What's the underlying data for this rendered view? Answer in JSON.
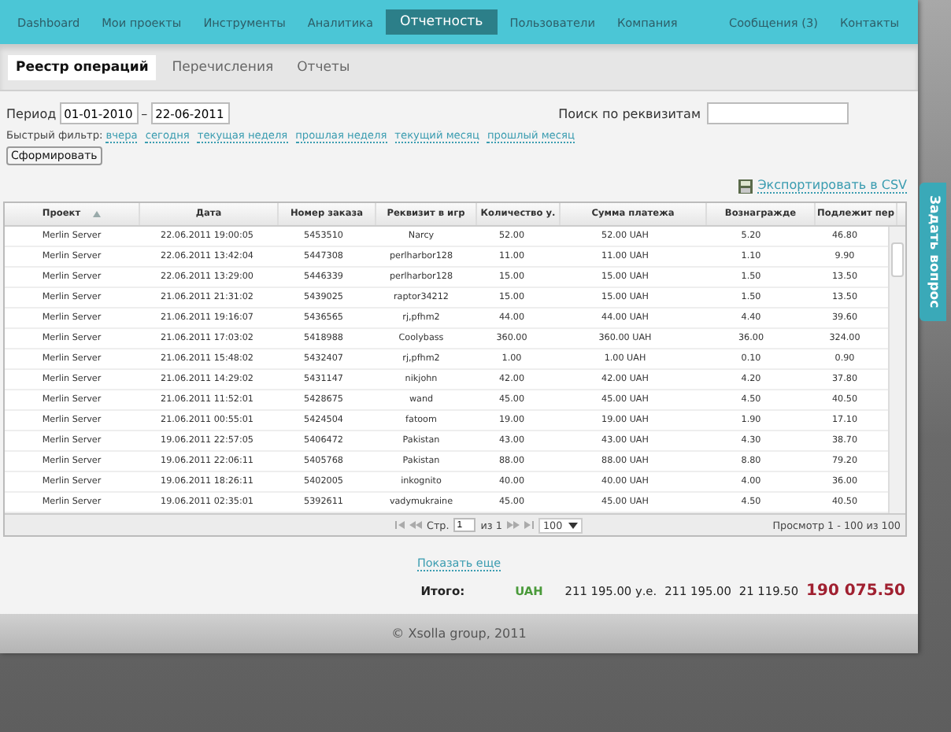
{
  "nav": {
    "items": [
      {
        "label": "Dashboard",
        "selected": false
      },
      {
        "label": "Мои проекты",
        "selected": false
      },
      {
        "label": "Инструменты",
        "selected": false
      },
      {
        "label": "Аналитика",
        "selected": false
      },
      {
        "label": "Отчетность",
        "selected": true
      },
      {
        "label": "Пользователи",
        "selected": false
      },
      {
        "label": "Компания",
        "selected": false
      }
    ],
    "right_items": [
      {
        "label": "Сообщения (3)",
        "selected": false
      },
      {
        "label": "Контакты",
        "selected": false
      }
    ]
  },
  "subtabs": [
    {
      "label": "Реестр операций",
      "selected": true
    },
    {
      "label": "Перечисления",
      "selected": false
    },
    {
      "label": "Отчеты",
      "selected": false
    }
  ],
  "filter": {
    "period_label": "Период",
    "date_from": "01-01-2010",
    "dash": "–",
    "date_to": "22-06-2011",
    "search_label": "Поиск по реквизитам",
    "quick_label": "Быстрый фильтр:",
    "quick_links": [
      "вчера",
      "сегодня",
      "текущая неделя",
      "прошлая неделя",
      "текущий месяц",
      "прошлый месяц"
    ],
    "submit": "Сформировать"
  },
  "export_link": "Экспортировать в CSV",
  "table": {
    "columns": [
      {
        "label": "Проект",
        "sorted": true
      },
      {
        "label": "Дата",
        "sorted": false
      },
      {
        "label": "Номер заказа",
        "sorted": false
      },
      {
        "label": "Реквизит в игр",
        "sorted": false
      },
      {
        "label": "Количество у.",
        "sorted": false
      },
      {
        "label": "Сумма платежа",
        "sorted": false
      },
      {
        "label": "Вознагражде",
        "sorted": false
      },
      {
        "label": "Подлежит пер",
        "sorted": false
      }
    ],
    "rows": [
      [
        "Merlin Server",
        "22.06.2011 19:00:05",
        "5453510",
        "Narcy",
        "52.00",
        "52.00 UAH",
        "5.20",
        "46.80"
      ],
      [
        "Merlin Server",
        "22.06.2011 13:42:04",
        "5447308",
        "perlharbor128",
        "11.00",
        "11.00 UAH",
        "1.10",
        "9.90"
      ],
      [
        "Merlin Server",
        "22.06.2011 13:29:00",
        "5446339",
        "perlharbor128",
        "15.00",
        "15.00 UAH",
        "1.50",
        "13.50"
      ],
      [
        "Merlin Server",
        "21.06.2011 21:31:02",
        "5439025",
        "raptor34212",
        "15.00",
        "15.00 UAH",
        "1.50",
        "13.50"
      ],
      [
        "Merlin Server",
        "21.06.2011 19:16:07",
        "5436565",
        "rj,pfhm2",
        "44.00",
        "44.00 UAH",
        "4.40",
        "39.60"
      ],
      [
        "Merlin Server",
        "21.06.2011 17:03:02",
        "5418988",
        "Coolybass",
        "360.00",
        "360.00 UAH",
        "36.00",
        "324.00"
      ],
      [
        "Merlin Server",
        "21.06.2011 15:48:02",
        "5432407",
        "rj,pfhm2",
        "1.00",
        "1.00 UAH",
        "0.10",
        "0.90"
      ],
      [
        "Merlin Server",
        "21.06.2011 14:29:02",
        "5431147",
        "nikjohn",
        "42.00",
        "42.00 UAH",
        "4.20",
        "37.80"
      ],
      [
        "Merlin Server",
        "21.06.2011 11:52:01",
        "5428675",
        "wand",
        "45.00",
        "45.00 UAH",
        "4.50",
        "40.50"
      ],
      [
        "Merlin Server",
        "21.06.2011 00:55:01",
        "5424504",
        "fatoom",
        "19.00",
        "19.00 UAH",
        "1.90",
        "17.10"
      ],
      [
        "Merlin Server",
        "19.06.2011 22:57:05",
        "5406472",
        "Pakistan",
        "43.00",
        "43.00 UAH",
        "4.30",
        "38.70"
      ],
      [
        "Merlin Server",
        "19.06.2011 22:06:11",
        "5405768",
        "Pakistan",
        "88.00",
        "88.00 UAH",
        "8.80",
        "79.20"
      ],
      [
        "Merlin Server",
        "19.06.2011 18:26:11",
        "5402005",
        "inkognito",
        "40.00",
        "40.00 UAH",
        "4.00",
        "36.00"
      ],
      [
        "Merlin Server",
        "19.06.2011 02:35:01",
        "5392611",
        "vadymukraine",
        "45.00",
        "45.00 UAH",
        "4.50",
        "40.50"
      ]
    ],
    "pager": {
      "page_label": "Стр.",
      "page": "1",
      "of": "из 1",
      "page_size": "100",
      "summary": "Просмотр 1 - 100 из 100"
    }
  },
  "show_more": "Показать еще",
  "totals": {
    "label": "Итого:",
    "currency": "UAH",
    "values": [
      {
        "text": "211 195.00 у.е.",
        "kind": "plain"
      },
      {
        "text": "211 195.00",
        "kind": "plain"
      },
      {
        "text": "21 119.50",
        "kind": "plain"
      },
      {
        "text": "190 075.50",
        "kind": "grand"
      }
    ]
  },
  "footer": "© Xsolla group, 2011",
  "side_tab": "Задать вопрос"
}
